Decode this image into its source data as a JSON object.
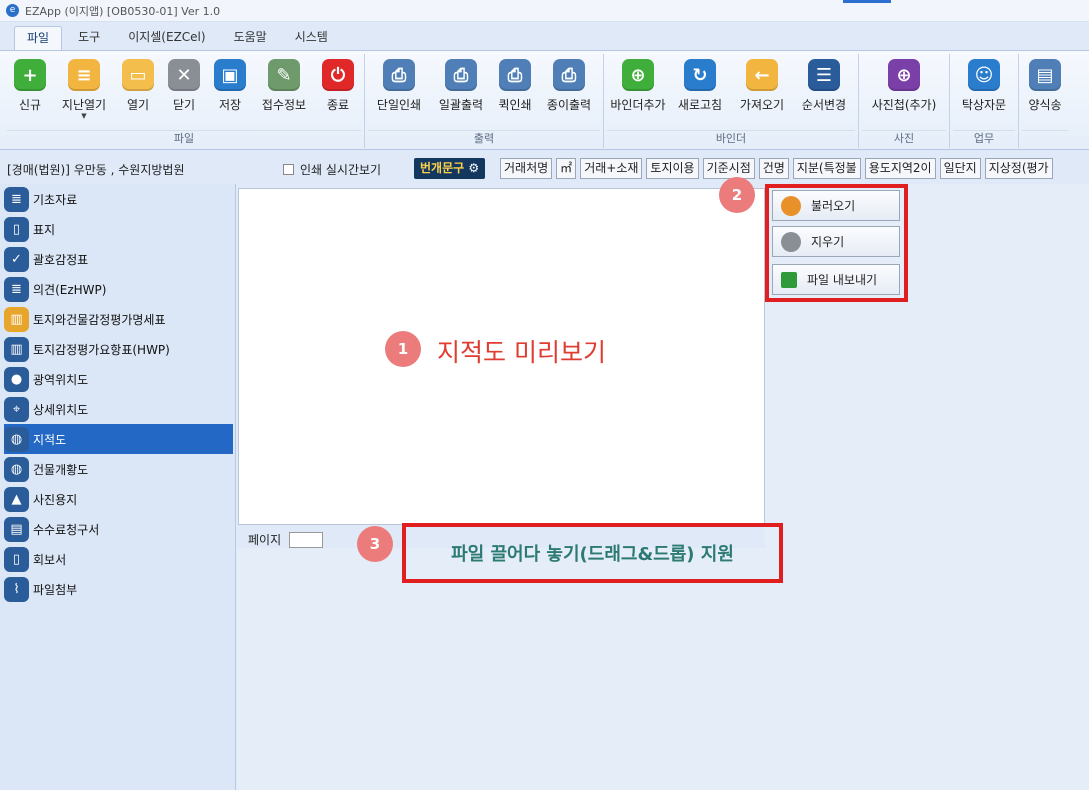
{
  "window": {
    "title": "EZApp (이지앱) [OB0530-01] Ver 1.0"
  },
  "menu_tabs": [
    "파일",
    "도구",
    "이지셀(EZCel)",
    "도움말",
    "시스템"
  ],
  "ribbon": {
    "groups": [
      {
        "label": "파일",
        "buttons": [
          "신규",
          "지난열기",
          "열기",
          "닫기",
          "저장",
          "접수정보",
          "종료"
        ]
      },
      {
        "label": "출력",
        "buttons": [
          "단일인쇄",
          "일괄출력",
          "퀵인쇄",
          "종이출력"
        ]
      },
      {
        "label": "바인더",
        "buttons": [
          "바인더추가",
          "새로고침",
          "가져오기",
          "순서변경"
        ]
      },
      {
        "label": "사진",
        "buttons": [
          "사진첩(추가)"
        ]
      },
      {
        "label": "업무",
        "buttons": [
          "탁상자문"
        ]
      },
      {
        "label": "",
        "buttons": [
          "양식송"
        ]
      }
    ]
  },
  "infobar": {
    "court": "[경매(법원)] 우만동 , 수원지방법원",
    "print_preview_label": "인쇄 실시간보기",
    "bunge_button": "번개문구",
    "chips": [
      "거래처명",
      "㎡",
      "거래+소재",
      "토지이용",
      "기준시점",
      "건명",
      "지분(특정불",
      "용도지역2이",
      "일단지",
      "지상정(평가"
    ]
  },
  "sidebar": {
    "items": [
      "기초자료",
      "표지",
      "괄호감정표",
      "의견(EzHWP)",
      "토지와건물감정평가명세표",
      "토지감정평가요항표(HWP)",
      "광역위치도",
      "상세위치도",
      "지적도",
      "건물개황도",
      "사진용지",
      "수수료청구서",
      "회보서",
      "파일첨부"
    ],
    "active_index": 8
  },
  "page_label": "페이지",
  "side_buttons": [
    "불러오기",
    "지우기",
    "파일 내보내기"
  ],
  "annotations": [
    {
      "number": "1",
      "text": "지적도 미리보기"
    },
    {
      "number": "2",
      "text": ""
    },
    {
      "number": "3",
      "text": "파일 끌어다 놓기(드래그&드롭) 지원"
    }
  ],
  "colors": {
    "accent": "#2368c4",
    "annotation_red": "#e02020",
    "badge": "#ec7b7b",
    "annotation_teal": "#2c7a73"
  }
}
